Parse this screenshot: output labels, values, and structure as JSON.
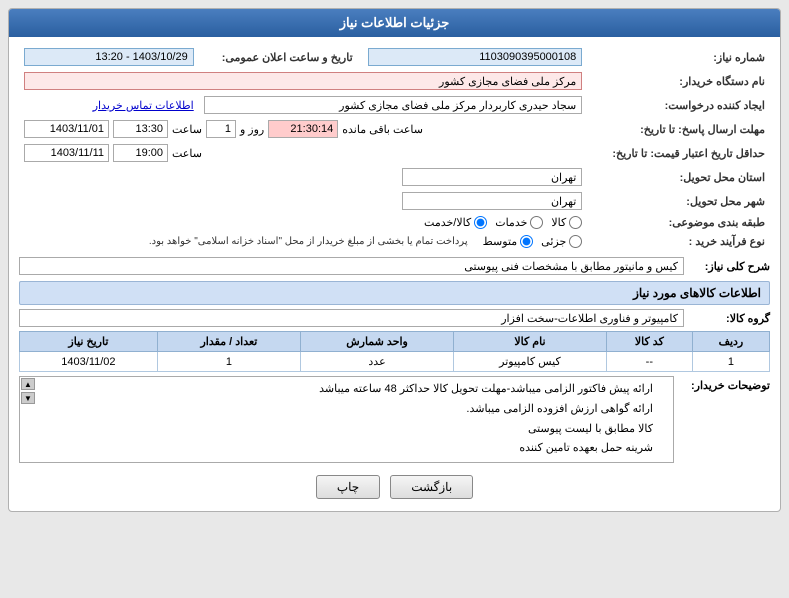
{
  "header": {
    "title": "جزئیات اطلاعات نیاز"
  },
  "fields": {
    "shomare_niaz_label": "شماره نیاز:",
    "shomare_niaz_value": "1103090395000108",
    "nam_dastgah_label": "نام دستگاه خریدار:",
    "nam_dastgah_value": "مرکز ملی فضای مجازی کشور",
    "ijad_label": "ایجاد کننده درخواست:",
    "ijad_value": "سجاد حیدری کاربردار مرکز ملی فضای مجازی کشور",
    "ijad_link": "اطلاعات تماس خریدار",
    "mohlat_label": "مهلت ارسال پاسخ: تا تاریخ:",
    "mohlat_date": "1403/11/01",
    "mohlat_saat": "13:30",
    "mohlat_rooz": "1",
    "mohlat_countdown": "21:30:14",
    "mohlat_remaining": "ساعت باقی مانده",
    "tarikh_label": "حداقل تاریخ اعتبار قیمت: تا تاریخ:",
    "tarikh_date": "1403/11/11",
    "tarikh_saat": "19:00",
    "ostan_label": "استان محل تحویل:",
    "ostan_value": "تهران",
    "shahr_label": "شهر محل تحویل:",
    "shahr_value": "تهران",
    "tabaqe_label": "طبقه بندی موضوعی:",
    "tabaqe_kala": "کالا",
    "tabaqe_khadamat": "خدمات",
    "tabaqe_kala_khadamat": "کالا/خدمت",
    "noe_label": "نوع فرآیند خرید :",
    "noe_jozvi": "جزئی",
    "noe_motavaset": "متوسط",
    "noe_notice": "پرداخت تمام یا بخشی از مبلغ خریدار از محل \"اسناد خزانه اسلامی\" خواهد بود.",
    "tarikh_niaz_label": "تاریخ و ساعت اعلان عمومی:",
    "tarikh_niaz_value": "1403/10/29 - 13:20"
  },
  "sherj_koli": {
    "label": "شرح کلی نیاز:",
    "value": "کیس و مانیتور مطابق با مشخصات فنی پیوستی"
  },
  "kala_section": {
    "title": "اطلاعات کالاهای مورد نیاز",
    "group_label": "گروه کالا:",
    "group_value": "کامپیوتر و فناوری اطلاعات-سخت افزار",
    "columns": [
      "ردیف",
      "کد کالا",
      "نام کالا",
      "واحد شمارش",
      "تعداد / مقدار",
      "تاریخ نیاز"
    ],
    "rows": [
      {
        "radif": "1",
        "kod": "--",
        "name": "کیس کامپیوتر",
        "vahed": "عدد",
        "tedad": "1",
        "tarikh": "1403/11/02"
      }
    ]
  },
  "notes": {
    "label": "توضیحات خریدار:",
    "lines": [
      "ارائه پیش فاکتور الزامی میباشد-مهلت تحویل کالا حداکثر 48 ساعته میباشد",
      "ارائه گواهی ارزش افزوده الزامی میباشد.",
      "کالا مطابق با لیست پیوستی",
      "شرینه حمل بعهده تامین کننده"
    ]
  },
  "buttons": {
    "chap": "چاپ",
    "bazgasht": "بازگشت"
  }
}
